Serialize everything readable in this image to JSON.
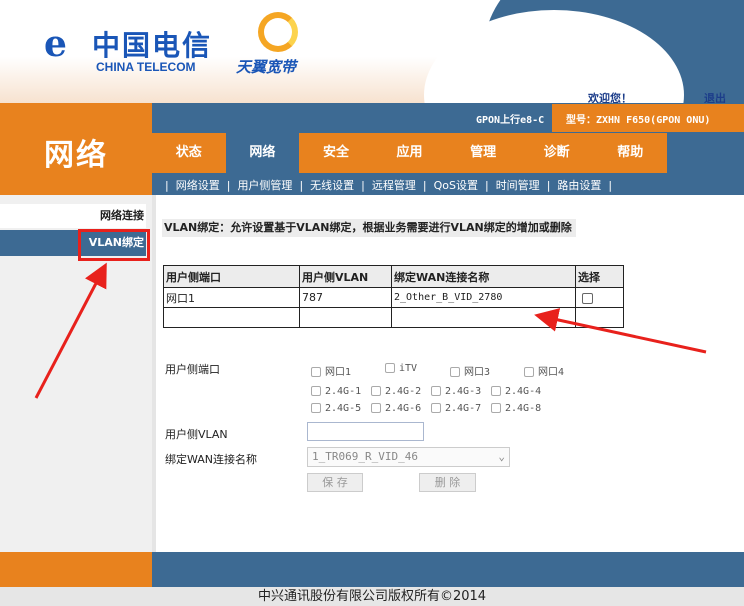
{
  "brand": {
    "logo_cn": "中国电信",
    "logo_en": "CHINA TELECOM",
    "product_logo": "天翼宽带"
  },
  "header": {
    "welcome": "欢迎您！",
    "logout": "退出",
    "device": "GPON上行e8-C",
    "model": "型号：ZXHN F650(GPON ONU)"
  },
  "section_title": "网络",
  "tabs": [
    {
      "label": "状态",
      "active": false
    },
    {
      "label": "网络",
      "active": true
    },
    {
      "label": "安全",
      "active": false
    },
    {
      "label": "应用",
      "active": false
    },
    {
      "label": "管理",
      "active": false
    },
    {
      "label": "诊断",
      "active": false
    },
    {
      "label": "帮助",
      "active": false
    }
  ],
  "subnav": [
    "网络设置",
    "用户侧管理",
    "无线设置",
    "远程管理",
    "QoS设置",
    "时间管理",
    "路由设置"
  ],
  "sidebar": {
    "items": [
      {
        "label": "网络连接",
        "active": false
      },
      {
        "label": "VLAN绑定",
        "active": true
      }
    ]
  },
  "description": "VLAN绑定：允许设置基于VLAN绑定，根据业务需要进行VLAN绑定的增加或删除",
  "table": {
    "headers": [
      "用户侧端口",
      "用户侧VLAN",
      "绑定WAN连接名称",
      "选择"
    ],
    "rows": [
      {
        "port": "网口1",
        "vlan": "787",
        "wan": "2_Other_B_VID_2780"
      }
    ]
  },
  "form": {
    "port_label": "用户侧端口",
    "ports_row1": [
      "网口1",
      "iTV",
      "网口3",
      "网口4"
    ],
    "ports_row2": [
      "2.4G-1",
      "2.4G-2",
      "2.4G-3",
      "2.4G-4"
    ],
    "ports_row3": [
      "2.4G-5",
      "2.4G-6",
      "2.4G-7",
      "2.4G-8"
    ],
    "vlan_label": "用户侧VLAN",
    "vlan_value": "",
    "wan_label": "绑定WAN连接名称",
    "wan_selected": "1_TR069_R_VID_46",
    "save": "保 存",
    "delete": "删 除"
  },
  "footer": "中兴通讯股份有限公司版权所有©2014",
  "colors": {
    "orange": "#e8821e",
    "blue": "#3d6a93",
    "annotation_red": "#e8211c"
  }
}
